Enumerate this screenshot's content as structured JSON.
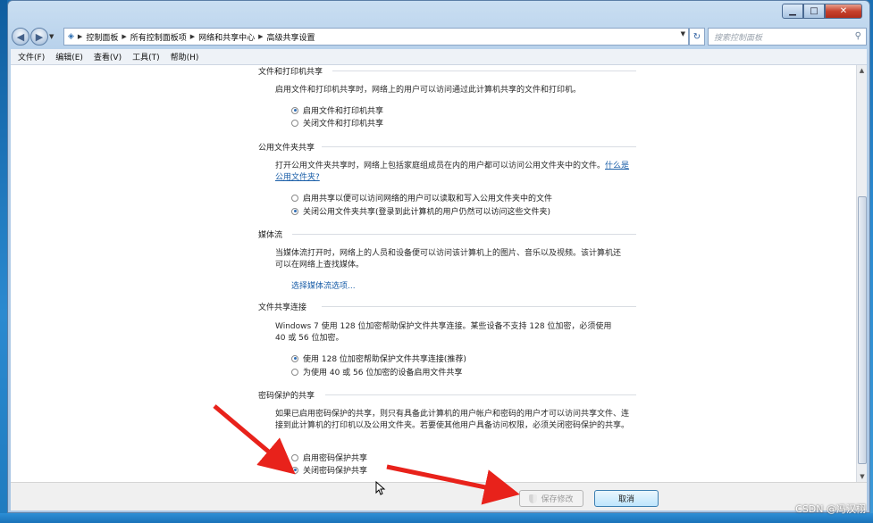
{
  "window": {
    "min_label": "▁",
    "max_label": "□",
    "close_label": "✕"
  },
  "nav": {
    "breadcrumbs": [
      "控制面板",
      "所有控制面板项",
      "网络和共享中心",
      "高级共享设置"
    ],
    "search_placeholder": "搜索控制面板"
  },
  "menu": [
    "文件(F)",
    "编辑(E)",
    "查看(V)",
    "工具(T)",
    "帮助(H)"
  ],
  "sections": {
    "file_printer": {
      "title": "文件和打印机共享",
      "desc": "启用文件和打印机共享时，网络上的用户可以访问通过此计算机共享的文件和打印机。",
      "opt_on": "启用文件和打印机共享",
      "opt_off": "关闭文件和打印机共享",
      "selected": "on"
    },
    "public_folder": {
      "title": "公用文件夹共享",
      "desc": "打开公用文件夹共享时，网络上包括家庭组成员在内的用户都可以访问公用文件夹中的文件。",
      "link": "什么是公用文件夹?",
      "opt_on": "启用共享以便可以访问网络的用户可以读取和写入公用文件夹中的文件",
      "opt_off": "关闭公用文件夹共享(登录到此计算机的用户仍然可以访问这些文件夹)",
      "selected": "off"
    },
    "media": {
      "title": "媒体流",
      "desc": "当媒体流打开时，网络上的人员和设备便可以访问该计算机上的图片、音乐以及视频。该计算机还可以在网络上查找媒体。",
      "link": "选择媒体流选项..."
    },
    "connection": {
      "title": "文件共享连接",
      "desc": "Windows 7 使用 128 位加密帮助保护文件共享连接。某些设备不支持 128 位加密，必须使用 40 或 56 位加密。",
      "opt_128": "使用 128 位加密帮助保护文件共享连接(推荐)",
      "opt_40": "为使用 40 或 56 位加密的设备启用文件共享",
      "selected": "128"
    },
    "password": {
      "title": "密码保护的共享",
      "desc": "如果已启用密码保护的共享，则只有具备此计算机的用户帐户和密码的用户才可以访问共享文件、连接到此计算机的打印机以及公用文件夹。若要使其他用户具备访问权限，必须关闭密码保护的共享。",
      "opt_on": "启用密码保护共享",
      "opt_off": "关闭密码保护共享",
      "selected": "off"
    }
  },
  "footer": {
    "save": "保存修改",
    "cancel": "取消"
  },
  "watermark": "CSDN @冯汉栩",
  "colors": {
    "annotation_arrow": "#e8221b",
    "link": "#1a5ea8",
    "accent": "#2f6db5"
  }
}
